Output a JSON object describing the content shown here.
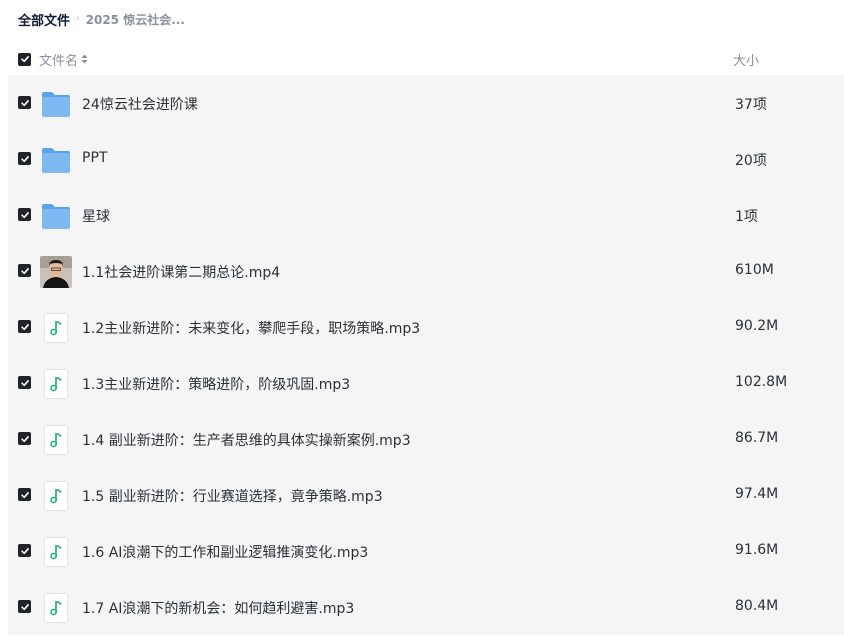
{
  "breadcrumb": {
    "root": "全部文件",
    "separator": "›",
    "current": "2025 惊云社会..."
  },
  "header": {
    "name_label": "文件名",
    "size_label": "大小"
  },
  "files": [
    {
      "name": "24惊云社会进阶课",
      "size": "37项",
      "type": "folder-icon"
    },
    {
      "name": "PPT",
      "size": "20项",
      "type": "folder-icon"
    },
    {
      "name": "星球",
      "size": "1项",
      "type": "folder-icon"
    },
    {
      "name": "1.1社会进阶课第二期总论.mp4",
      "size": "610M",
      "type": "video-thumbnail"
    },
    {
      "name": "1.2主业新进阶：未来变化，攀爬手段，职场策略.mp3",
      "size": "90.2M",
      "type": "audio-file-icon"
    },
    {
      "name": "1.3主业新进阶：策略进阶，阶级巩固.mp3",
      "size": "102.8M",
      "type": "audio-file-icon"
    },
    {
      "name": "1.4 副业新进阶：生产者思维的具体实操新案例.mp3",
      "size": "86.7M",
      "type": "audio-file-icon"
    },
    {
      "name": "1.5 副业新进阶：行业赛道选择，竟争策略.mp3",
      "size": "97.4M",
      "type": "audio-file-icon"
    },
    {
      "name": "1.6 AI浪潮下的工作和副业逻辑推演变化.mp3",
      "size": "91.6M",
      "type": "audio-file-icon"
    },
    {
      "name": "1.7 AI浪潮下的新机会：如何趋利避害.mp3",
      "size": "80.4M",
      "type": "audio-file-icon"
    }
  ],
  "colors": {
    "folder": "#7db8f0",
    "audio_note": "#2bb673",
    "row_bg": "#f5f5f5"
  }
}
